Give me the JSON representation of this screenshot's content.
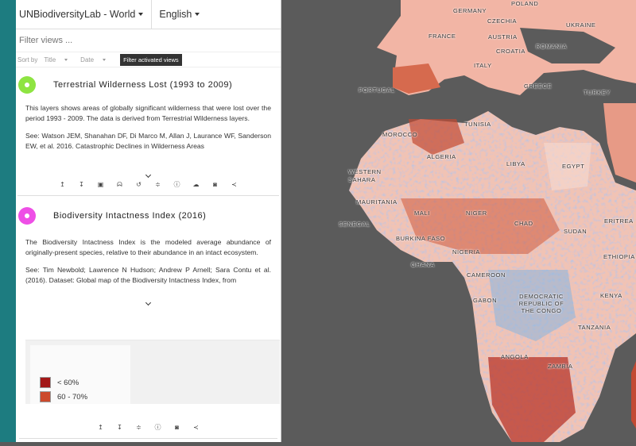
{
  "header": {
    "site_dropdown": "UNBiodiversityLab - World",
    "language_dropdown": "English"
  },
  "filter": {
    "placeholder": "Filter views ..."
  },
  "sortbar": {
    "sort_by": "Sort by",
    "title": "Title",
    "date": "Date",
    "filter_button": "Filter activated views"
  },
  "layers": [
    {
      "title": "Terrestrial Wilderness Lost (1993 to 2009)",
      "dot_color": "#8ee442",
      "description": "This layers shows areas of globally significant wilderness that were lost over the period 1993 - 2009. The data is derived from Terrestrial Wilderness layers.",
      "citation": "See: Watson JEM, Shanahan DF, Di Marco M, Allan J, Laurance WF, Sanderson EW, et al. 2016. Catastrophic Declines in Wilderness Areas"
    },
    {
      "title": "Biodiversity Intactness Index (2016)",
      "dot_color": "#ee4fe6",
      "description": "The Biodiversity Intactness Index is the modeled average abundance of originally-present species, relative to their abundance in an intact ecosystem.",
      "citation": "See: Tim Newbold; Lawrence N Hudson; Andrew P Arnell; Sara Contu et al. (2016). Dataset: Global map of the Biodiversity Intactness Index, from"
    }
  ],
  "legend": {
    "items": [
      {
        "label": "< 60%",
        "color": "#a31818"
      },
      {
        "label": "60 - 70%",
        "color": "#cc4a2c"
      }
    ]
  },
  "map": {
    "labels": {
      "germany": "GERMANY",
      "poland": "POLAND",
      "czechia": "CZECHIA",
      "ukraine": "UKRAINE",
      "france": "FRANCE",
      "austria": "AUSTRIA",
      "croatia": "CROATIA",
      "romania": "ROMANIA",
      "italy": "ITALY",
      "portugal": "PORTUGAL",
      "greece": "GREECE",
      "turkey": "TURKEY",
      "tunisia": "TUNISIA",
      "morocco": "MOROCCO",
      "algeria": "ALGERIA",
      "libya": "LIBYA",
      "egypt": "EGYPT",
      "western_sahara": "WESTERN SAHARA",
      "mauritania": "MAURITANIA",
      "mali": "MALI",
      "niger": "NIGER",
      "chad": "CHAD",
      "sudan": "SUDAN",
      "senegal": "SENEGAL",
      "burkina_faso": "BURKINA FASO",
      "nigeria": "NIGERIA",
      "eritrea": "ERITREA",
      "ethiopia": "ETHIOPIA",
      "ghana": "GHANA",
      "cameroon": "CAMEROON",
      "gabon": "GABON",
      "drc": "DEMOCRATIC REPUBLIC OF THE CONGO",
      "kenya": "KENYA",
      "tanzania": "TANZANIA",
      "angola": "ANGOLA",
      "zambia": "ZAMBIA"
    }
  }
}
